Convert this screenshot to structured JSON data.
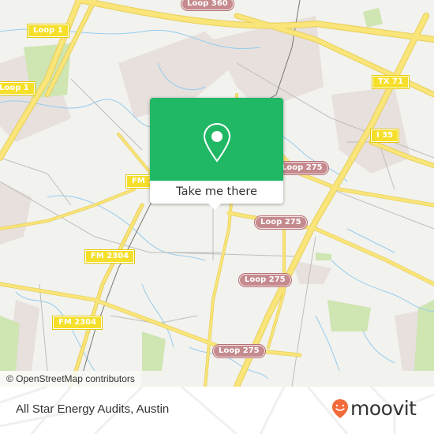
{
  "map": {
    "attribution": "© OpenStreetMap contributors",
    "road_labels": [
      {
        "text": "Loop 360",
        "style": "loop"
      },
      {
        "text": "Loop 1",
        "style": "yellow"
      },
      {
        "text": "Loop 1",
        "style": "yellow"
      },
      {
        "text": "TX 71",
        "style": "yellow"
      },
      {
        "text": "I 35",
        "style": "yellow"
      },
      {
        "text": "FM 1",
        "style": "yellow"
      },
      {
        "text": "Loop 275",
        "style": "loop"
      },
      {
        "text": "Loop 275",
        "style": "loop"
      },
      {
        "text": "FM 2304",
        "style": "yellow"
      },
      {
        "text": "Loop 275",
        "style": "loop"
      },
      {
        "text": "FM 2304",
        "style": "yellow"
      },
      {
        "text": "Loop 275",
        "style": "loop"
      }
    ],
    "colors": {
      "background": "#f2f2ee",
      "highway": "#f8e36a",
      "park": "#cde6b0",
      "water": "#8ec8ec",
      "urban": "#e6dfdc"
    }
  },
  "popup": {
    "icon": "map-pin-icon",
    "button_label": "Take me there",
    "color": "#20b865"
  },
  "footer": {
    "place_name": "All Star Energy Audits, Austin",
    "brand": "moovit",
    "brand_color": "#f26b3a"
  }
}
